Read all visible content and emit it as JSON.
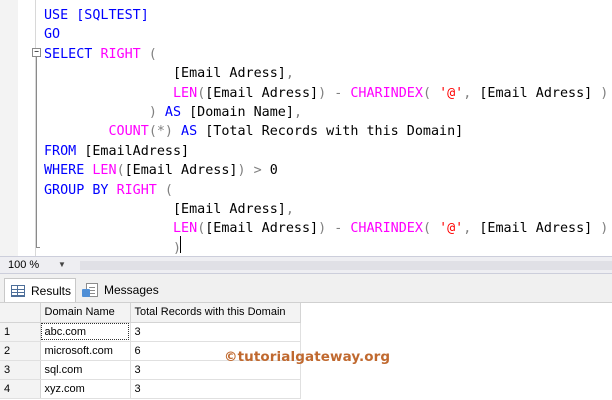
{
  "editor": {
    "lines": [
      [
        {
          "t": "USE [SQLTEST]",
          "c": "kw"
        }
      ],
      [
        {
          "t": "GO",
          "c": "kw"
        }
      ],
      [
        {
          "t": "SELECT ",
          "c": "kw"
        },
        {
          "t": "RIGHT",
          "c": "fn"
        },
        {
          "t": " (",
          "c": "op"
        }
      ],
      [
        {
          "t": "                [Email Adress]",
          "c": "blk"
        },
        {
          "t": ",",
          "c": "op"
        }
      ],
      [
        {
          "t": "                ",
          "c": "blk"
        },
        {
          "t": "LEN",
          "c": "fn"
        },
        {
          "t": "(",
          "c": "op"
        },
        {
          "t": "[Email Adress]",
          "c": "blk"
        },
        {
          "t": ") - ",
          "c": "op"
        },
        {
          "t": "CHARINDEX",
          "c": "fn"
        },
        {
          "t": "( ",
          "c": "op"
        },
        {
          "t": "'@'",
          "c": "str"
        },
        {
          "t": ", ",
          "c": "op"
        },
        {
          "t": "[Email Adress]",
          "c": "blk"
        },
        {
          "t": " )",
          "c": "op"
        }
      ],
      [
        {
          "t": "             ",
          "c": "blk"
        },
        {
          "t": ")",
          "c": "op"
        },
        {
          "t": " AS ",
          "c": "kw"
        },
        {
          "t": "[Domain Name]",
          "c": "blk"
        },
        {
          "t": ",",
          "c": "op"
        }
      ],
      [
        {
          "t": "        ",
          "c": "blk"
        },
        {
          "t": "COUNT",
          "c": "fn"
        },
        {
          "t": "(*)",
          "c": "op"
        },
        {
          "t": " AS ",
          "c": "kw"
        },
        {
          "t": "[Total Records with this Domain]",
          "c": "blk"
        }
      ],
      [
        {
          "t": "FROM ",
          "c": "kw"
        },
        {
          "t": "[EmailAdress]",
          "c": "blk"
        }
      ],
      [
        {
          "t": "WHERE ",
          "c": "kw"
        },
        {
          "t": "LEN",
          "c": "fn"
        },
        {
          "t": "(",
          "c": "op"
        },
        {
          "t": "[Email Adress]",
          "c": "blk"
        },
        {
          "t": ") > ",
          "c": "op"
        },
        {
          "t": "0",
          "c": "blk"
        }
      ],
      [
        {
          "t": "GROUP BY ",
          "c": "kw"
        },
        {
          "t": "RIGHT",
          "c": "fn"
        },
        {
          "t": " (",
          "c": "op"
        }
      ],
      [
        {
          "t": "                [Email Adress]",
          "c": "blk"
        },
        {
          "t": ",",
          "c": "op"
        }
      ],
      [
        {
          "t": "                ",
          "c": "blk"
        },
        {
          "t": "LEN",
          "c": "fn"
        },
        {
          "t": "(",
          "c": "op"
        },
        {
          "t": "[Email Adress]",
          "c": "blk"
        },
        {
          "t": ") - ",
          "c": "op"
        },
        {
          "t": "CHARINDEX",
          "c": "fn"
        },
        {
          "t": "( ",
          "c": "op"
        },
        {
          "t": "'@'",
          "c": "str"
        },
        {
          "t": ", ",
          "c": "op"
        },
        {
          "t": "[Email Adress]",
          "c": "blk"
        },
        {
          "t": " )",
          "c": "op"
        }
      ],
      [
        {
          "t": "                ",
          "c": "blk"
        },
        {
          "t": ")",
          "c": "op"
        }
      ]
    ],
    "colors": {
      "keyword": "#0000ff",
      "function": "#ff00ff",
      "operator": "#808080",
      "string": "#ff0000"
    }
  },
  "zoom": {
    "value": "100 %"
  },
  "tabs": {
    "results": "Results",
    "messages": "Messages",
    "results_icon": "grid-icon",
    "messages_icon": "message-icon"
  },
  "results": {
    "columns": [
      "",
      "Domain Name",
      "Total Records with this Domain"
    ],
    "rows": [
      [
        "1",
        "abc.com",
        "3"
      ],
      [
        "2",
        "microsoft.com",
        "6"
      ],
      [
        "3",
        "sql.com",
        "3"
      ],
      [
        "4",
        "xyz.com",
        "3"
      ]
    ]
  },
  "watermark": "©tutorialgateway.org"
}
